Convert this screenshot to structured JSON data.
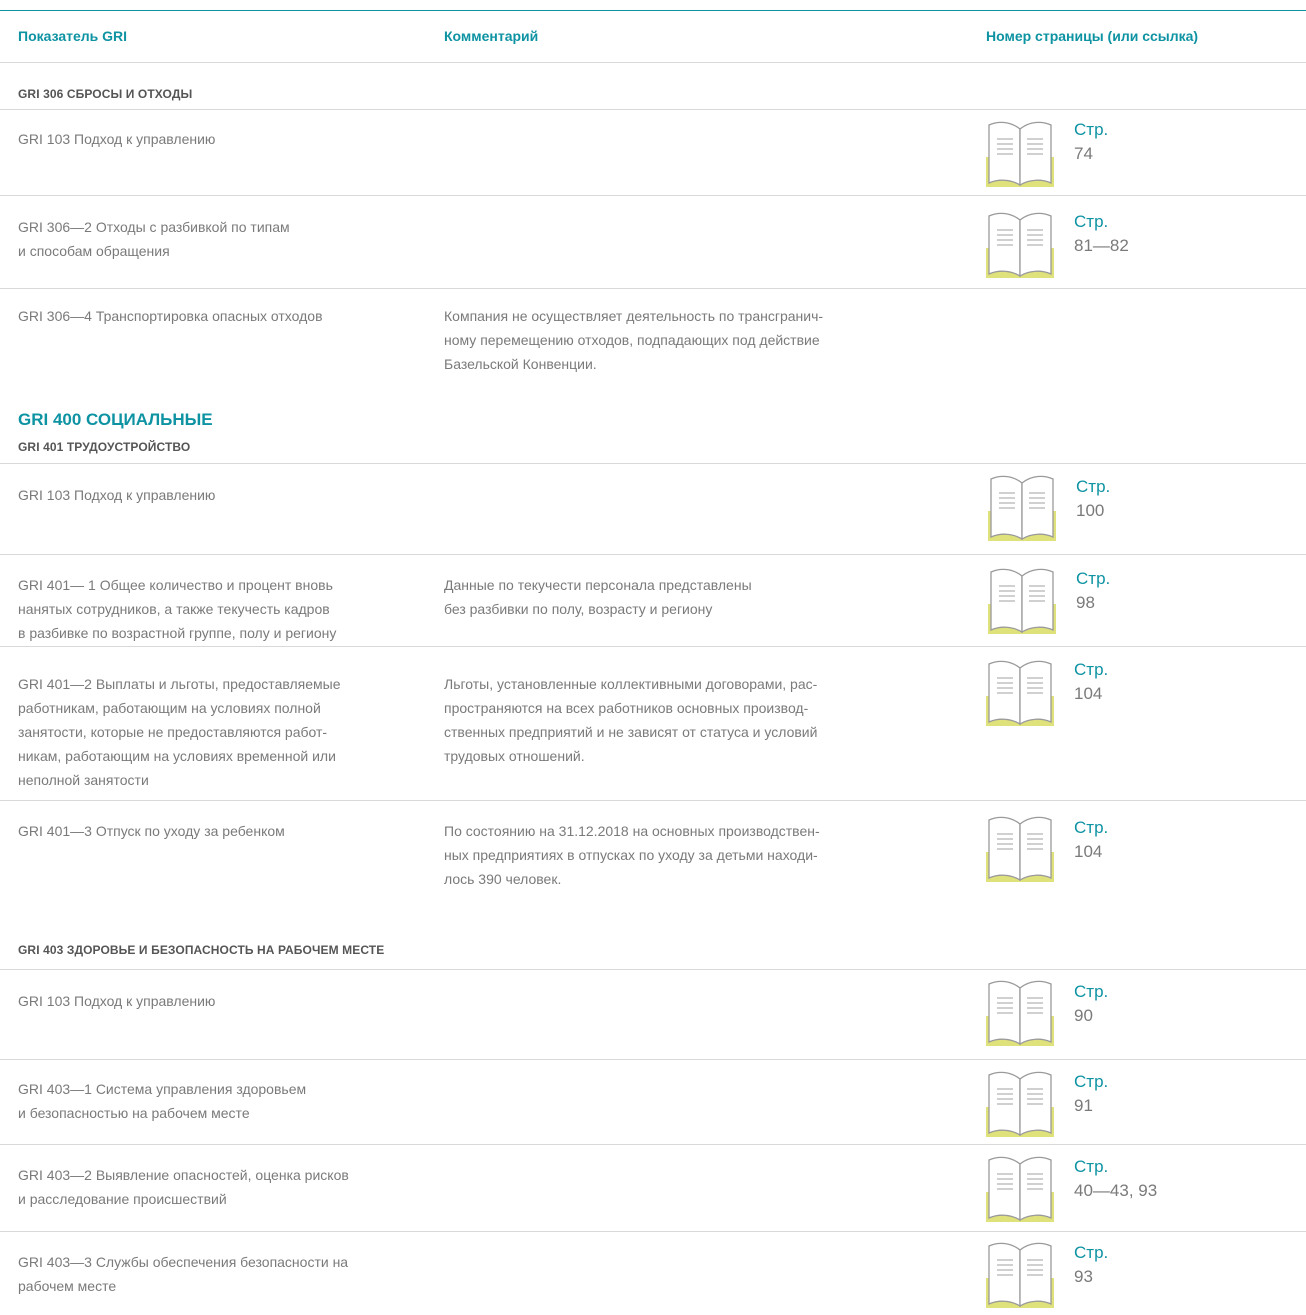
{
  "header": {
    "col1": "Показатель GRI",
    "col2": "Комментарий",
    "col3": "Номер страницы (или ссылка)"
  },
  "sections": {
    "s306": "GRI 306 СБРОСЫ И ОТХОДЫ",
    "s400": "GRI 400 СОЦИАЛЬНЫЕ",
    "s401": "GRI 401 ТРУДОУСТРОЙСТВО",
    "s403": "GRI 403 ЗДОРОВЬЕ И БЕЗОПАСНОСТЬ НА РАБОЧЕМ МЕСТЕ"
  },
  "page_label": "Стр.",
  "rows": [
    {
      "indicator": "GRI 103 Подход к управлению",
      "comment": "",
      "page": "74"
    },
    {
      "indicator": "GRI 306—2 Отходы с разбивкой по типам\nи способам обращения",
      "comment": "",
      "page": "81—82"
    },
    {
      "indicator": "GRI 306—4 Транспортировка опасных отходов",
      "comment": "Компания не осуществляет деятельность по трансгранич-\nному перемещению отходов, подпадающих под действие\nБазельской Конвенции.",
      "page": ""
    },
    {
      "indicator": "GRI 103 Подход к управлению",
      "comment": "",
      "page": "100"
    },
    {
      "indicator": "GRI 401— 1 Общее количество и процент вновь\nнанятых сотрудников, а также текучесть кадров\nв разбивке по возрастной группе, полу и региону",
      "comment": "Данные по текучести персонала представлены\nбез разбивки по полу, возрасту и региону",
      "page": "98"
    },
    {
      "indicator": "GRI 401—2 Выплаты и льготы, предоставляемые\nработникам, работающим на условиях полной\nзанятости, которые не предоставляются работ-\nникам, работающим на условиях временной или\nнеполной занятости",
      "comment": "Льготы, установленные коллективными договорами, рас-\nпространяются на всех работников основных производ-\nственных предприятий и не зависят от статуса и условий\nтрудовых отношений.",
      "page": "104"
    },
    {
      "indicator": "GRI 401—3 Отпуск по уходу за ребенком",
      "comment": "По состоянию на 31.12.2018 на основных производствен-\nных предприятиях в отпусках по уходу за детьми находи-\nлось 390 человек.",
      "page": "104"
    },
    {
      "indicator": "GRI 103 Подход к управлению",
      "comment": "",
      "page": "90"
    },
    {
      "indicator": "GRI 403—1 Система управления здоровьем\nи безопасностью на рабочем месте",
      "comment": "",
      "page": "91"
    },
    {
      "indicator": "GRI 403—2 Выявление опасностей, оценка рисков\nи расследование происшествий",
      "comment": "",
      "page": "40—43, 93"
    },
    {
      "indicator": "GRI 403—3 Службы обеспечения безопасности на\nрабочем месте",
      "comment": "",
      "page": "93"
    }
  ],
  "colors": {
    "accent": "#0e93a3",
    "book_highlight": "#dfe27a",
    "text": "#7a7a7a"
  }
}
